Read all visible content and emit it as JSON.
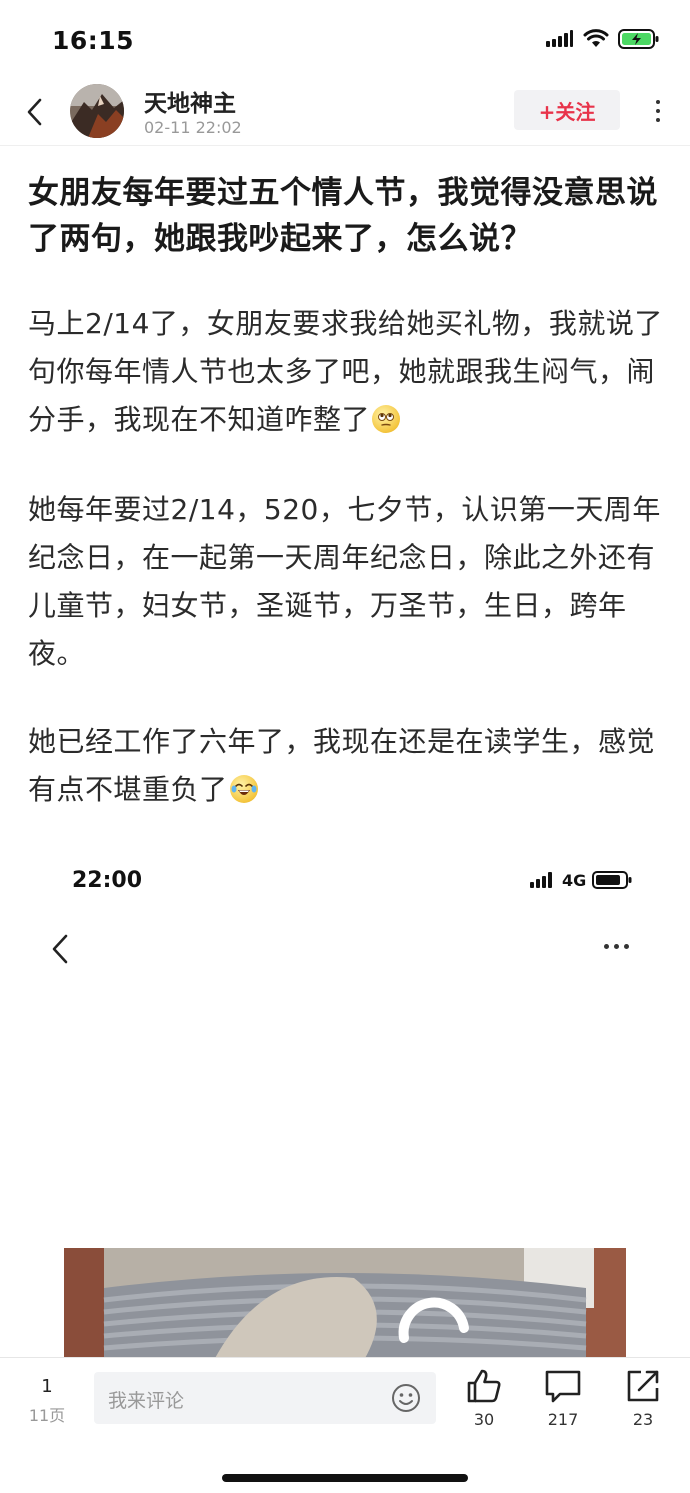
{
  "status_bar": {
    "time": "16:15"
  },
  "header": {
    "author_name": "天地神主",
    "post_time": "02-11 22:02",
    "follow_label": "+关注"
  },
  "article": {
    "title": "女朋友每年要过五个情人节，我觉得没意思说了两句，她跟我吵起来了，怎么说？",
    "paragraphs": [
      "马上2/14了，女朋友要求我给她买礼物，我就说了句你每年情人节也太多了吧，她就跟我生闷气，闹分手，我现在不知道咋整了",
      "她每年要过2/14，520，七夕节，认识第一天周年纪念日，在一起第一天周年纪念日，除此之外还有儿童节，妇女节，圣诞节，万圣节，生日，跨年夜。",
      "她已经工作了六年了，我现在还是在读学生，感觉有点不堪重负了"
    ],
    "paragraph_emojis": [
      "eye-roll-emoji",
      "none",
      "laughing-crying-emoji"
    ]
  },
  "embedded_screenshot": {
    "time": "22:00",
    "network": "4G"
  },
  "bottom_bar": {
    "page_current": "1",
    "page_total": "11页",
    "comment_placeholder": "我来评论",
    "like_count": "30",
    "comment_count": "217",
    "share_count": "23"
  },
  "colors": {
    "accent": "#e8334a",
    "text_primary": "#222222",
    "text_secondary": "#999999",
    "battery_fill": "#4cd964"
  }
}
